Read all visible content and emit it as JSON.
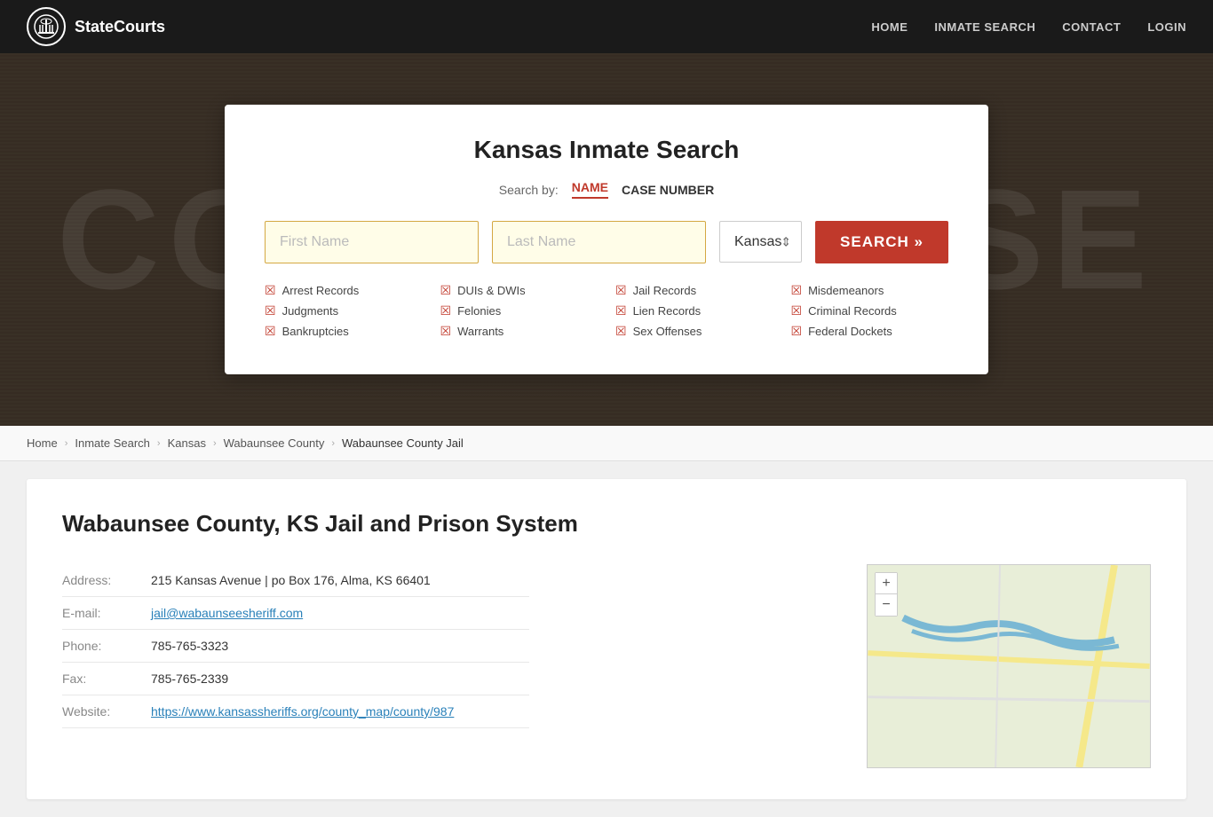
{
  "header": {
    "logo_text": "StateCourts",
    "nav": {
      "home": "HOME",
      "inmate_search": "INMATE SEARCH",
      "contact": "CONTACT",
      "login": "LOGIN"
    }
  },
  "search_card": {
    "title": "Kansas Inmate Search",
    "search_by_label": "Search by:",
    "tab_name": "NAME",
    "tab_case": "CASE NUMBER",
    "first_name_placeholder": "First Name",
    "last_name_placeholder": "Last Name",
    "state_value": "Kansas",
    "search_button": "SEARCH »",
    "checklist": [
      "Arrest Records",
      "Judgments",
      "Bankruptcies",
      "DUIs & DWIs",
      "Felonies",
      "Warrants",
      "Jail Records",
      "Lien Records",
      "Sex Offenses",
      "Misdemeanors",
      "Criminal Records",
      "Federal Dockets"
    ]
  },
  "breadcrumb": {
    "home": "Home",
    "inmate_search": "Inmate Search",
    "kansas": "Kansas",
    "wabaunsee": "Wabaunsee County",
    "current": "Wabaunsee County Jail"
  },
  "content": {
    "title": "Wabaunsee County, KS Jail and Prison System",
    "address_label": "Address:",
    "address_value": "215 Kansas Avenue | po Box 176, Alma, KS 66401",
    "email_label": "E-mail:",
    "email_value": "jail@wabaunseesheriff.com",
    "phone_label": "Phone:",
    "phone_value": "785-765-3323",
    "fax_label": "Fax:",
    "fax_value": "785-765-2339",
    "website_label": "Website:",
    "website_value": "https://www.kansassheriffs.org/county_map/county/987"
  },
  "map": {
    "plus": "+",
    "minus": "−"
  }
}
